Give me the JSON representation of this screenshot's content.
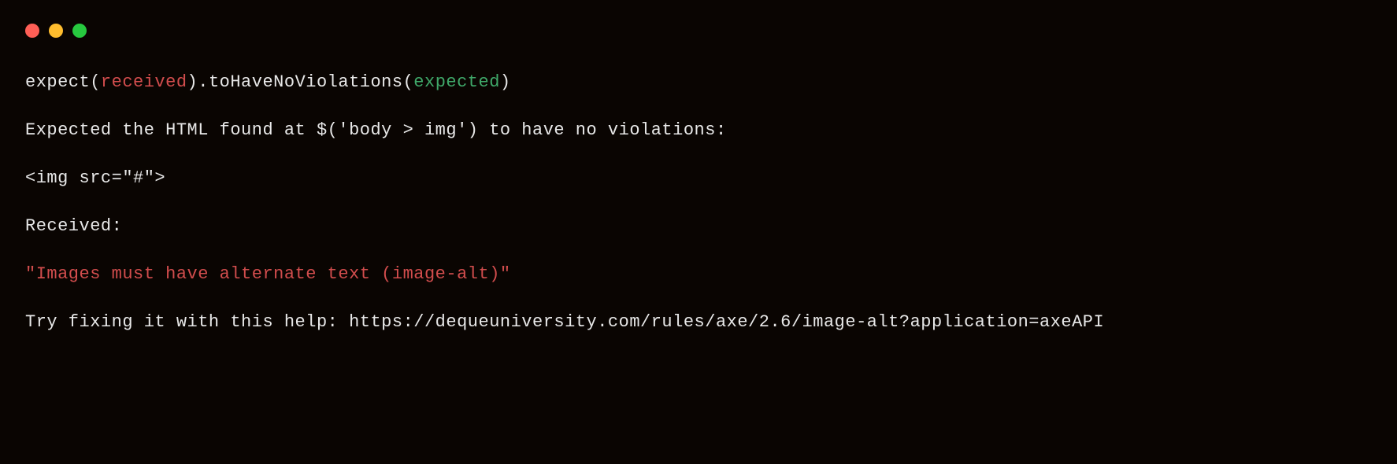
{
  "window_controls": {
    "close": "close",
    "minimize": "minimize",
    "maximize": "maximize"
  },
  "output": {
    "line1": {
      "p1": "expect(",
      "p2": "received",
      "p3": ").toHaveNoViolations(",
      "p4": "expected",
      "p5": ")"
    },
    "line2": "Expected the HTML found at $('body > img') to have no violations:",
    "line3": "<img src=\"#\">",
    "line4": "Received:",
    "line5": "\"Images must have alternate text (image-alt)\"",
    "line6": "Try fixing it with this help: https://dequeuniversity.com/rules/axe/2.6/image-alt?application=axeAPI"
  }
}
